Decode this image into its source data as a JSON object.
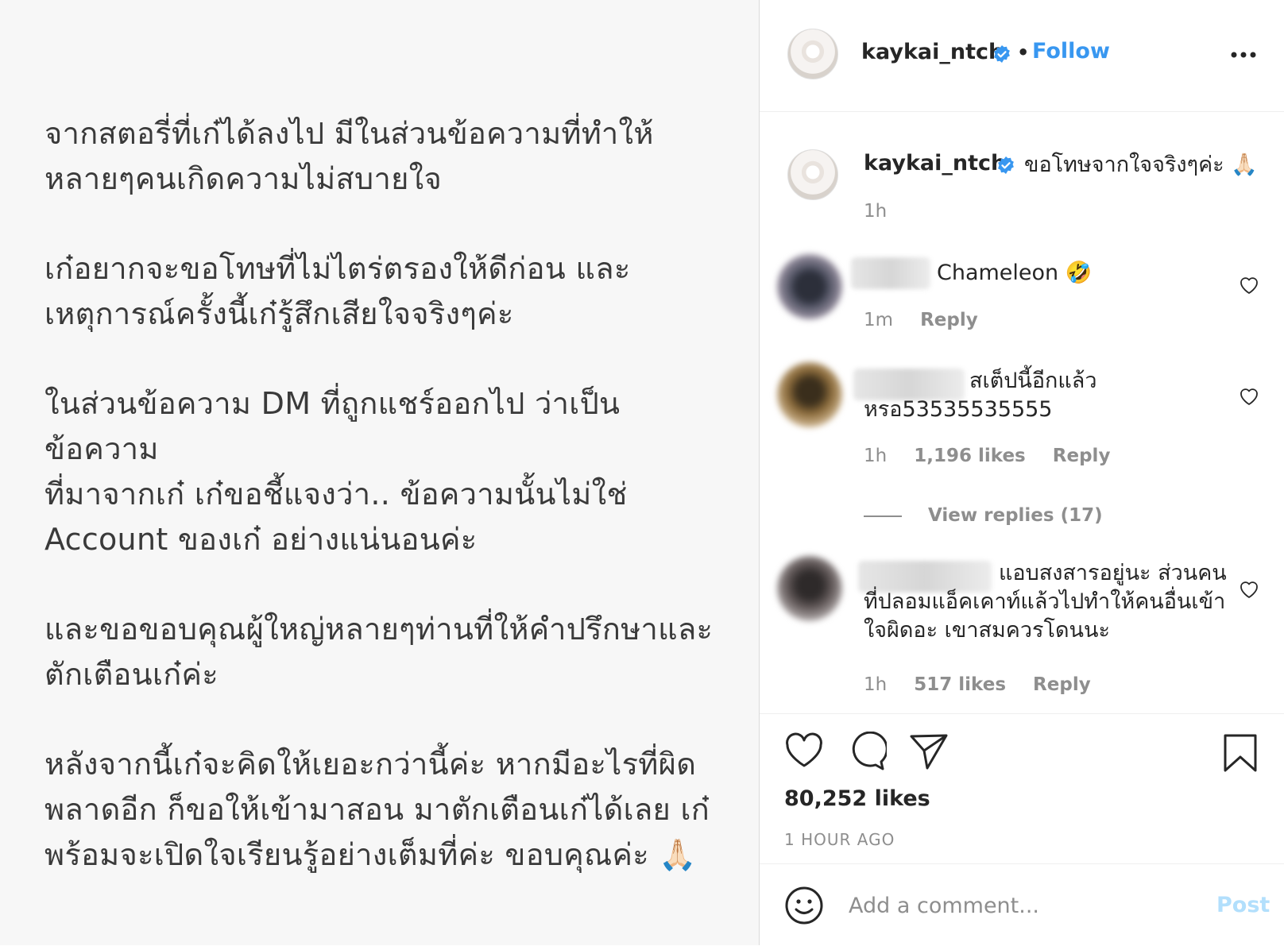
{
  "post": {
    "paragraphs": [
      "จากสตอรี่ที่เก๋ได้ลงไป มีในส่วนข้อความที่ทำให้\nหลายๆคนเกิดความไม่สบายใจ",
      "เก๋อยากจะขอโทษที่ไม่ไตร่ตรองให้ดีก่อน และ\nเหตุการณ์ครั้งนี้เก๋รู้สึกเสียใจจริงๆค่ะ",
      "ในส่วนข้อความ DM ที่ถูกแชร์ออกไป ว่าเป็นข้อความ\nที่มาจากเก๋ เก๋ขอชี้แจงว่า.. ข้อความนั้นไม่ใช่\nAccount ของเก๋ อย่างแน่นอนค่ะ",
      "และขอขอบคุณผู้ใหญ่หลายๆท่านที่ให้คำปรึกษาและ\nตักเตือนเก๋ค่ะ",
      "หลังจากนี้เก๋จะคิดให้เยอะกว่านี้ค่ะ หากมีอะไรที่ผิด\nพลาดอีก ก็ขอให้เข้ามาสอน มาตักเตือนเก๋ได้เลย เก๋\nพร้อมจะเปิดใจเรียนรู้อย่างเต็มที่ค่ะ ขอบคุณค่ะ 🙏🏻"
    ]
  },
  "header": {
    "username": "kaykai_ntch",
    "separator": "•",
    "follow_label": "Follow"
  },
  "caption": {
    "username": "kaykai_ntch",
    "text": "ขอโทษจากใจจริงๆค่ะ 🙏🏻",
    "time": "1h"
  },
  "comments": [
    {
      "text": "Chameleon 🤣",
      "time": "1m",
      "likes": "",
      "reply_label": "Reply"
    },
    {
      "text": "สเต็ปนี้อีกแล้ว\nหรอ53535535555",
      "time": "1h",
      "likes": "1,196 likes",
      "reply_label": "Reply",
      "view_replies": "View replies (17)"
    },
    {
      "text": "แอบสงสารอยู่นะ ส่วนคน\nที่ปลอมแอ็คเคาท์แล้วไปทำให้คนอื่นเข้า\nใจผิดอะ เขาสมควรโดนนะ",
      "time": "1h",
      "likes": "517 likes",
      "reply_label": "Reply"
    }
  ],
  "actions": {
    "likes": "80,252 likes",
    "time_ago": "1 HOUR AGO"
  },
  "comment_bar": {
    "placeholder": "Add a comment...",
    "post_label": "Post"
  },
  "colors": {
    "link_blue": "#3897f0",
    "post_disabled": "#b2dffc",
    "verified_blue": "#3897f0",
    "meta_gray": "#8e8e8e"
  }
}
